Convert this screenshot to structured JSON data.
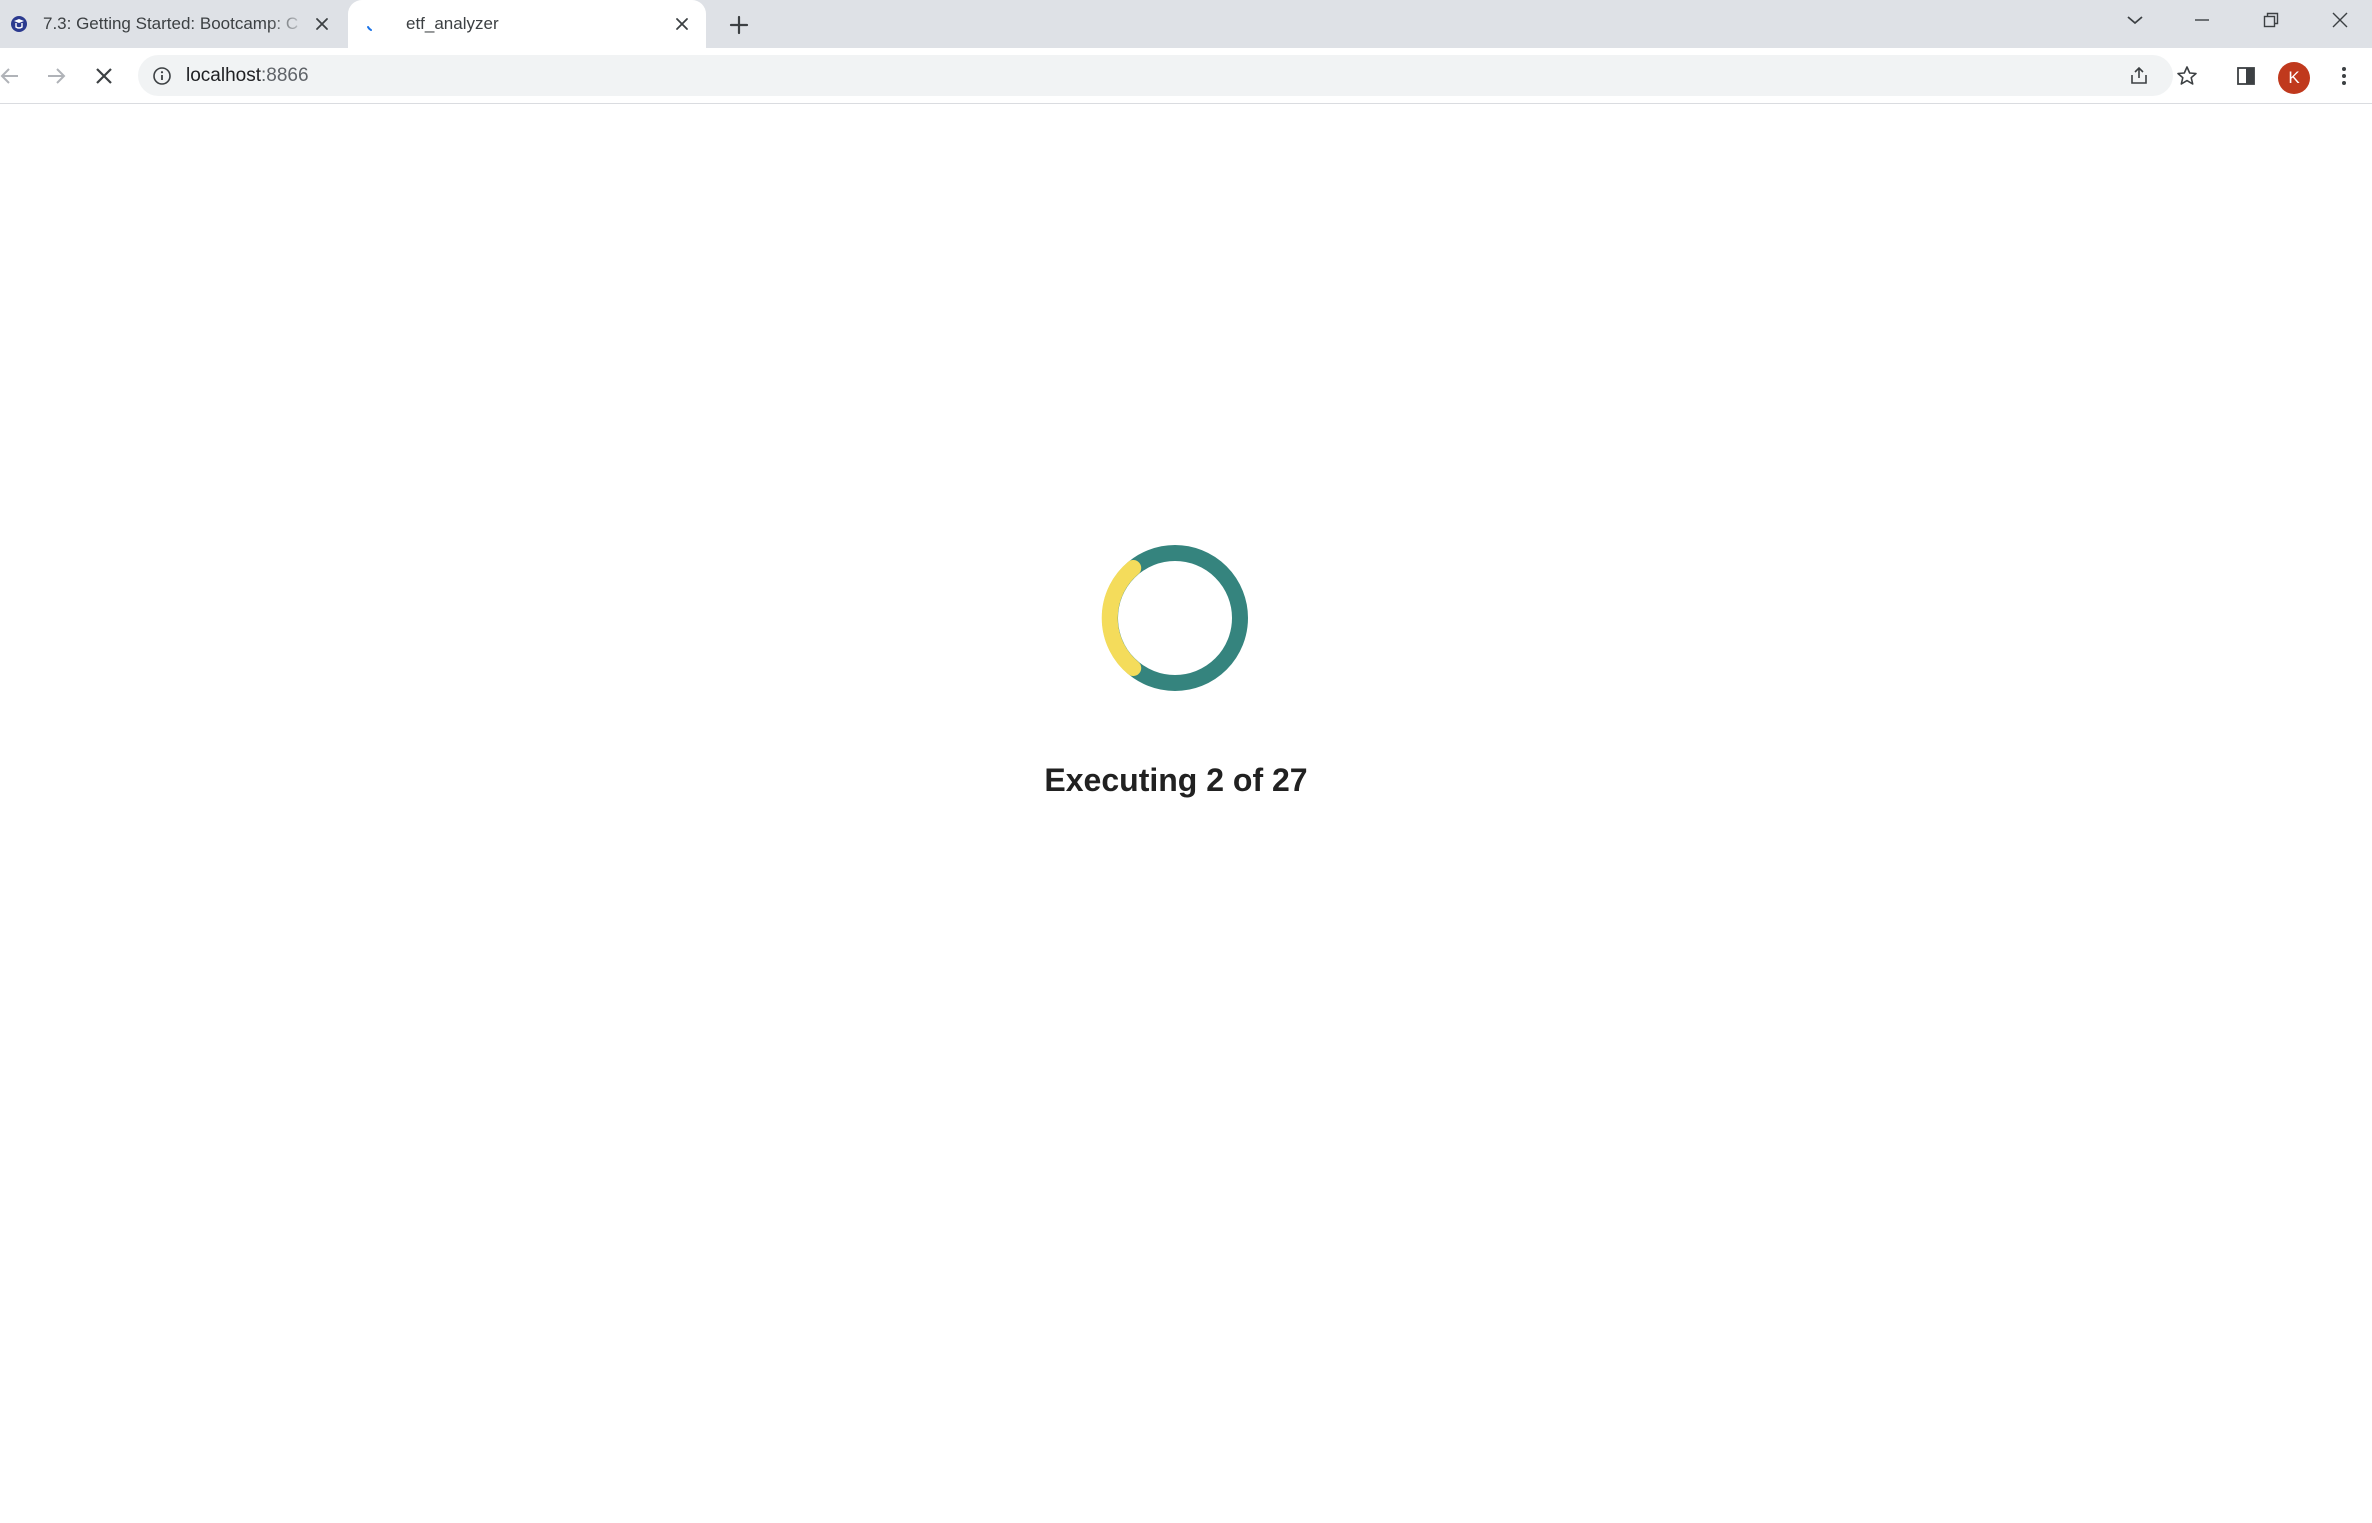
{
  "browser": {
    "tabs": [
      {
        "title": "7.3: Getting Started: Bootcamp: C",
        "icon": "graduation-cap-icon",
        "active": false
      },
      {
        "title": "etf_analyzer",
        "icon": "loading-spinner-icon",
        "active": true
      }
    ],
    "address_bar": {
      "host": "localhost",
      "port": ":8866"
    },
    "profile_initial": "K",
    "profile_color": "#c0391d"
  },
  "page": {
    "status_text": "Executing 2 of 27",
    "spinner": {
      "track_color": "#35847e",
      "accent_color": "#f4dc5b"
    }
  }
}
